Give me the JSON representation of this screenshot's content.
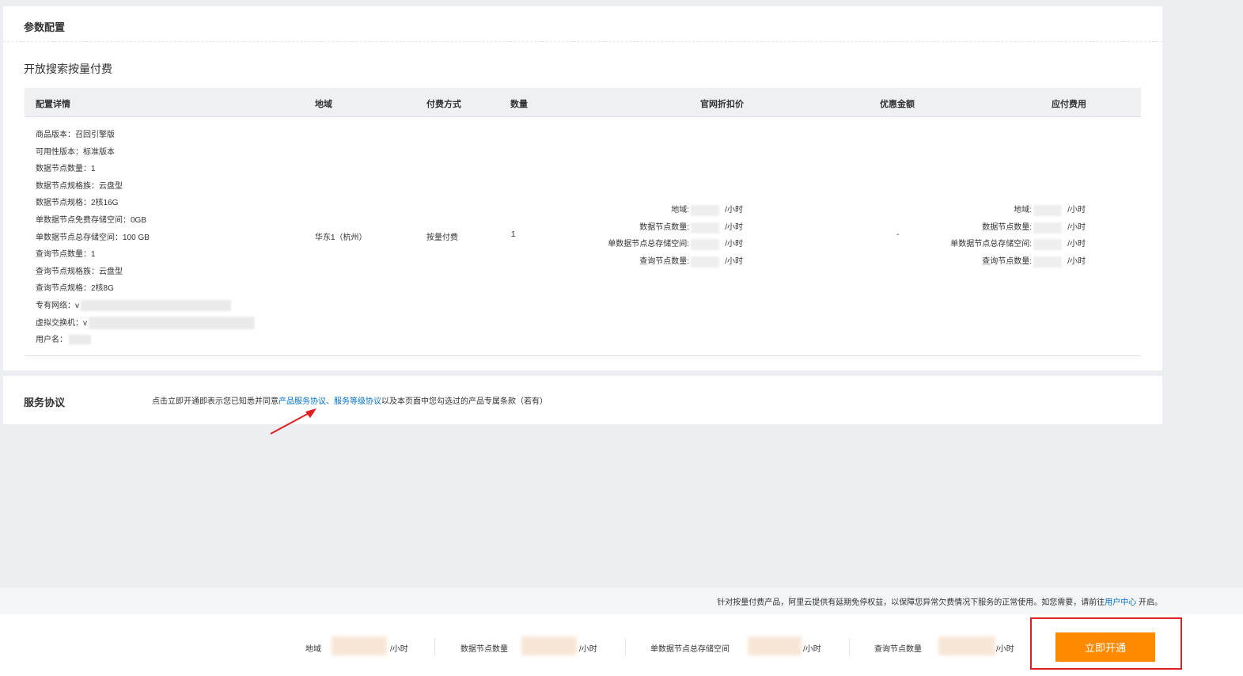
{
  "config_section": {
    "title": "参数配置",
    "product_title": "开放搜索按量付费",
    "table_headers": {
      "detail": "配置详情",
      "region": "地域",
      "billing": "付费方式",
      "quantity": "数量",
      "list_price": "官网折扣价",
      "discount": "优惠金额",
      "payable": "应付费用"
    },
    "details": [
      {
        "label": "商品版本：",
        "value": "召回引擎版"
      },
      {
        "label": "可用性版本：",
        "value": "标准版本"
      },
      {
        "label": "数据节点数量：",
        "value": "1"
      },
      {
        "label": "数据节点规格族：",
        "value": "云盘型"
      },
      {
        "label": "数据节点规格：",
        "value": "2核16G"
      },
      {
        "label": "单数据节点免费存储空间：",
        "value": "0GB"
      },
      {
        "label": "单数据节点总存储空间：",
        "value": "100 GB"
      },
      {
        "label": "查询节点数量：",
        "value": "1"
      },
      {
        "label": "查询节点规格族：",
        "value": "云盘型"
      },
      {
        "label": "查询节点规格：",
        "value": "2核8G"
      },
      {
        "label": "专有网络：",
        "value": "v"
      },
      {
        "label": "虚拟交换机：",
        "value": "v"
      },
      {
        "label": "用户名：",
        "value": ""
      }
    ],
    "row": {
      "region": "华东1（杭州）",
      "billing": "按量付费",
      "quantity": "1",
      "discount": "-"
    },
    "price_items": [
      {
        "label": "地域:",
        "unit": "/小时"
      },
      {
        "label": "数据节点数量:",
        "unit": "/小时"
      },
      {
        "label": "单数据节点总存储空间:",
        "unit": "/小时"
      },
      {
        "label": "查询节点数量:",
        "unit": "/小时"
      }
    ],
    "payable_items": [
      {
        "label": "地域:",
        "unit": "/小时"
      },
      {
        "label": "数据节点数量:",
        "unit": "/小时"
      },
      {
        "label": "单数据节点总存储空间:",
        "unit": "/小时"
      },
      {
        "label": "查询节点数量:",
        "unit": "/小时"
      }
    ]
  },
  "agreement": {
    "label": "服务协议",
    "text_before": "点击立即开通即表示您已知悉并同意",
    "link1": "产品服务协议",
    "separator": "、",
    "link2": "服务等级协议",
    "text_after": "以及本页面中您勾选过的产品专属条款（若有）"
  },
  "notice": {
    "text": "针对按量付费产品，阿里云提供有延期免停权益，以保障您异常欠费情况下服务的正常使用。如您需要，请前往",
    "link": "用户中心",
    "suffix": "开启。"
  },
  "footer": {
    "fees": [
      {
        "label": "地域",
        "unit": "/小时"
      },
      {
        "label": "数据节点数量",
        "unit": "/小时"
      },
      {
        "label": "单数据节点总存储空间",
        "unit": "/小时"
      },
      {
        "label": "查询节点数量",
        "unit": "/小时"
      }
    ],
    "button_label": "立即开通"
  },
  "colors": {
    "accent_orange": "#ff8a00",
    "link_blue": "#0070cc",
    "highlight_red": "#e02020"
  }
}
